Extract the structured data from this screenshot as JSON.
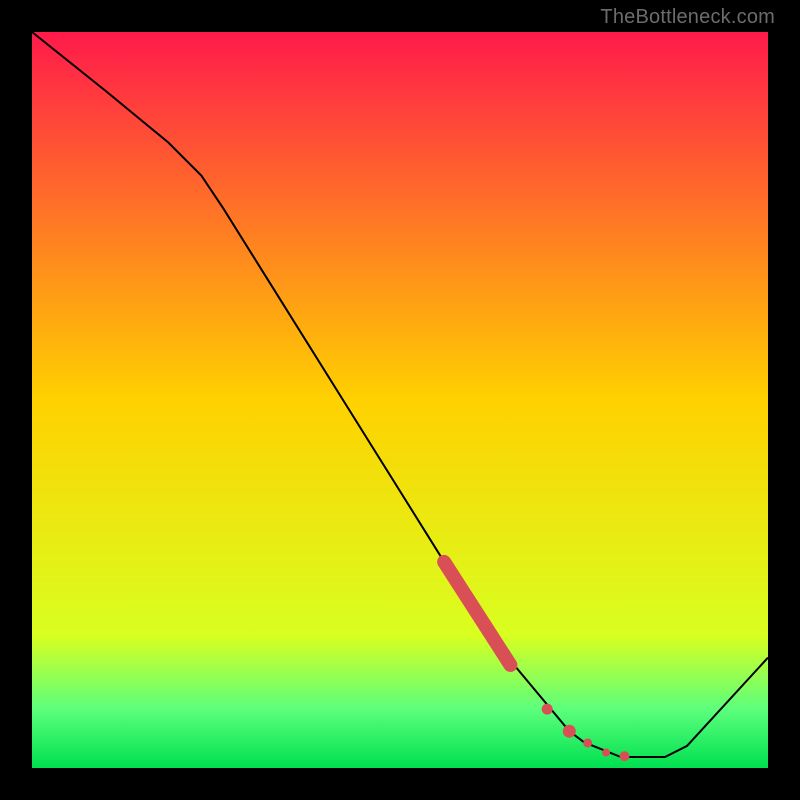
{
  "watermark": "TheBottleneck.com",
  "colors": {
    "top": "#ff1a4b",
    "mid": "#ffd100",
    "yellow_green": "#d8ff20",
    "green_top": "#5cff7c",
    "green_bot": "#00e050",
    "curve": "#000000",
    "marker_fill": "#d94f56",
    "marker_edge": "#b03a42",
    "frame": "#000000"
  },
  "chart_data": {
    "type": "line",
    "xlabel": "",
    "ylabel": "",
    "xlim": [
      0,
      100
    ],
    "ylim": [
      0,
      100
    ],
    "curve": [
      {
        "x": 0,
        "y": 100
      },
      {
        "x": 10,
        "y": 92
      },
      {
        "x": 18.5,
        "y": 85
      },
      {
        "x": 23,
        "y": 80.5
      },
      {
        "x": 26,
        "y": 76
      },
      {
        "x": 56,
        "y": 28
      },
      {
        "x": 58,
        "y": 25
      },
      {
        "x": 63,
        "y": 17
      },
      {
        "x": 73,
        "y": 5
      },
      {
        "x": 75,
        "y": 3.5
      },
      {
        "x": 80,
        "y": 1.5
      },
      {
        "x": 86,
        "y": 1.5
      },
      {
        "x": 89,
        "y": 3
      },
      {
        "x": 100,
        "y": 15
      }
    ],
    "thick_segment": [
      {
        "x": 56,
        "y": 28
      },
      {
        "x": 65,
        "y": 14
      }
    ],
    "dots": [
      {
        "x": 70,
        "y": 8,
        "r": 5.5
      },
      {
        "x": 73,
        "y": 5,
        "r": 6.5
      },
      {
        "x": 75.5,
        "y": 3.4,
        "r": 4.5
      },
      {
        "x": 78,
        "y": 2.1,
        "r": 4.0
      },
      {
        "x": 80.5,
        "y": 1.6,
        "r": 5.0
      }
    ]
  }
}
